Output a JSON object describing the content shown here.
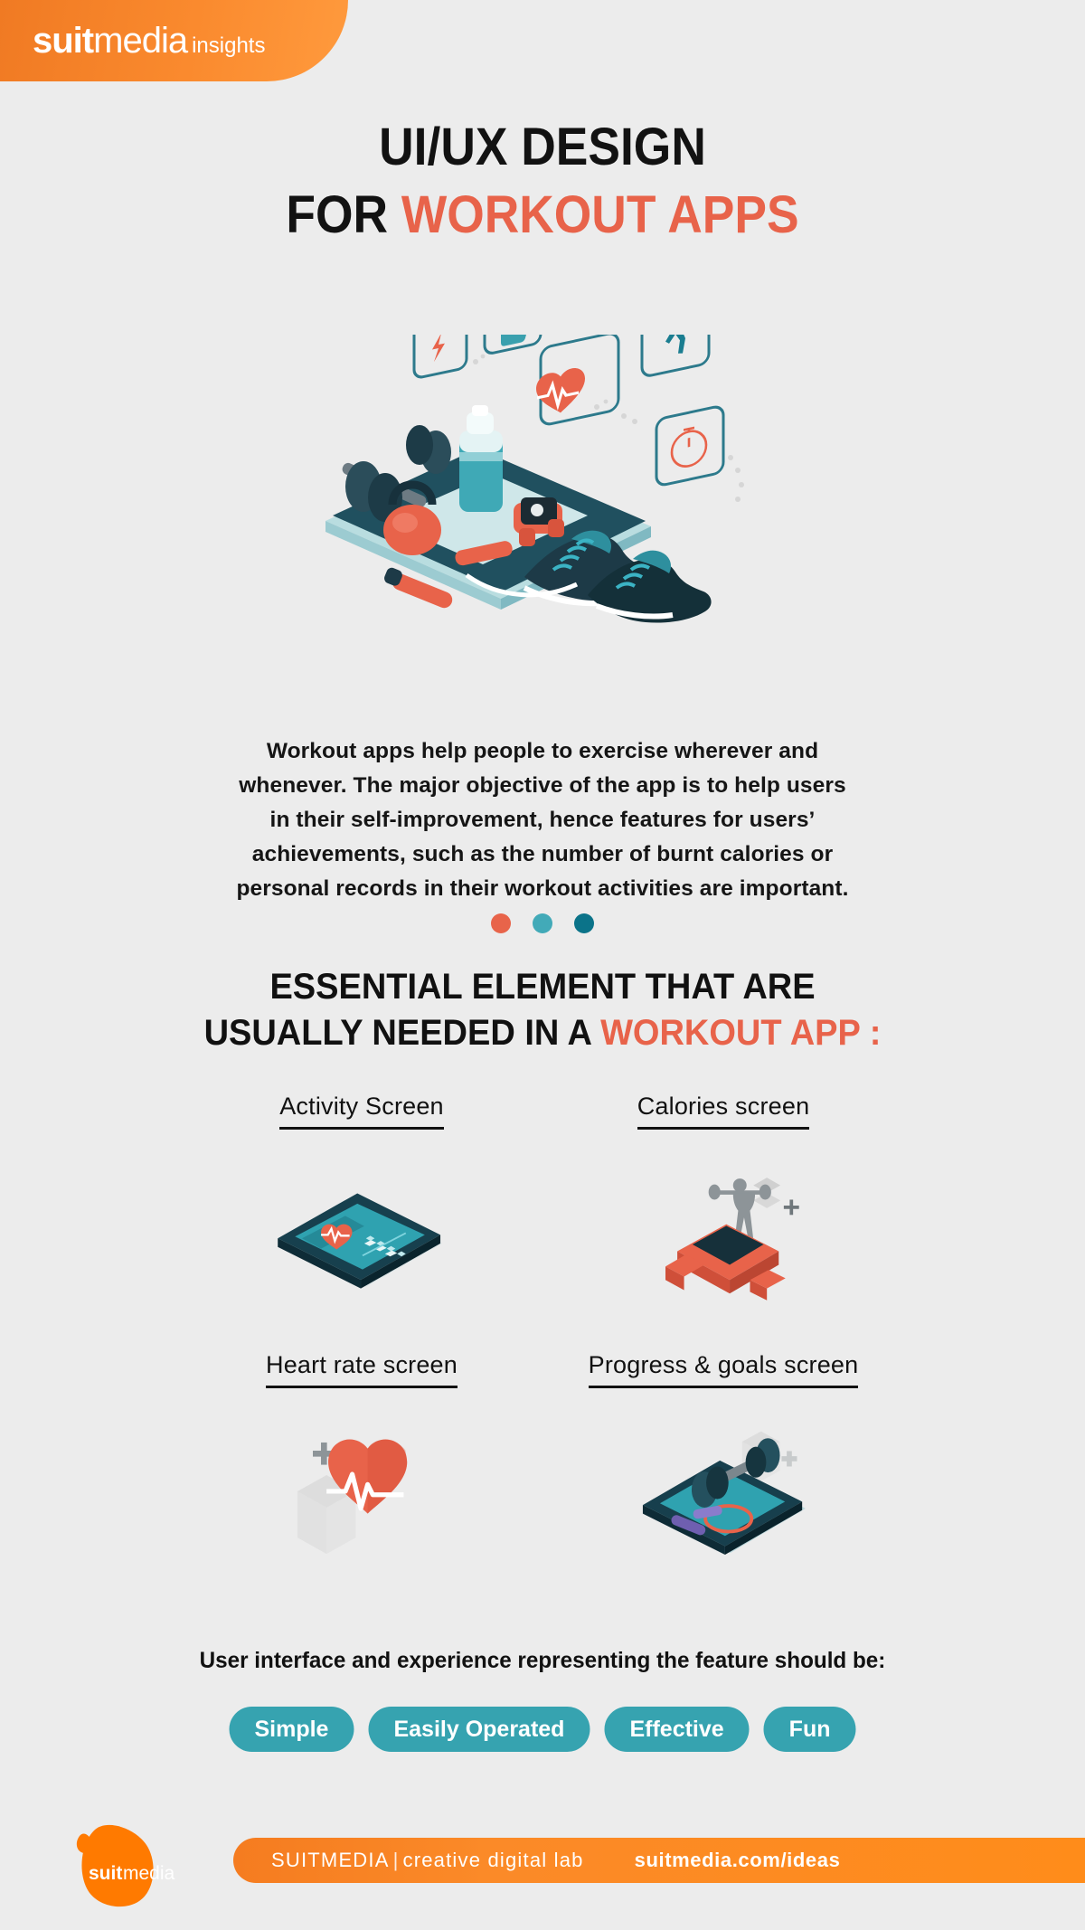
{
  "header": {
    "logo_bold": "suit",
    "logo_light": "media",
    "sub": "insights",
    "bg_color": "#fa8a2e"
  },
  "title": {
    "line1": "UI/UX DESIGN",
    "line2_plain": "FOR ",
    "line2_accent": "WORKOUT APPS",
    "accent_color": "#e8634a"
  },
  "lead": {
    "text": "Workout apps help people to exercise wherever and whenever. The major objective of the app is to help users in their self-improvement, hence features for users’ achievements, such as the number of burnt calories or personal records in their workout activities are important."
  },
  "dots": [
    {
      "name": "dot-coral",
      "color": "#e8644a"
    },
    {
      "name": "dot-teal-light",
      "color": "#42aab8"
    },
    {
      "name": "dot-teal-dark",
      "color": "#0b7389"
    }
  ],
  "section": {
    "line1": "ESSENTIAL ELEMENT THAT ARE",
    "line2_plain": "USUALLY NEEDED IN A ",
    "line2_accent": "WORKOUT APP :"
  },
  "features": [
    {
      "label": "Activity Screen",
      "icon": "phone-activity-screen-illustration"
    },
    {
      "label": "Calories screen",
      "icon": "smartwatch-calories-illustration"
    },
    {
      "label": "Heart rate screen",
      "icon": "heart-rate-illustration"
    },
    {
      "label": "Progress & goals screen",
      "icon": "dumbbell-progress-illustration"
    }
  ],
  "ui_line": {
    "text": "User interface and experience representing the feature should be:"
  },
  "pills": [
    {
      "label": "Simple"
    },
    {
      "label": "Easily Operated"
    },
    {
      "label": "Effective"
    },
    {
      "label": "Fun"
    }
  ],
  "pill_color": "#36a3b0",
  "footer": {
    "logo_bold": "suit",
    "logo_light": "media",
    "tagline_brand": "SUITMEDIA",
    "tagline_sep": "|",
    "tagline_text": "creative digital lab",
    "url": "suitmedia.com/ideas",
    "bar_color": "#fb8a28"
  },
  "hero": {
    "icon": "workout-gear-isometric-illustration"
  }
}
